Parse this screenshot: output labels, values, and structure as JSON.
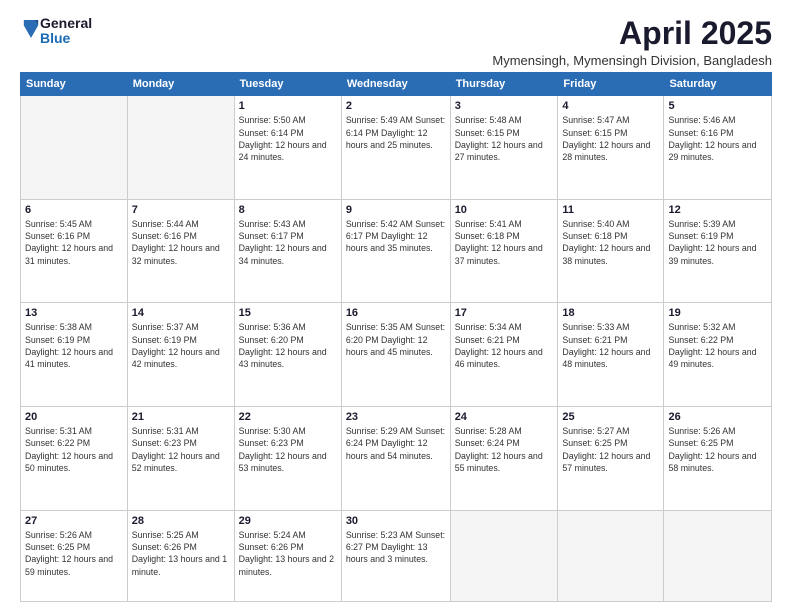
{
  "logo": {
    "general": "General",
    "blue": "Blue"
  },
  "title": "April 2025",
  "subtitle": "Mymensingh, Mymensingh Division, Bangladesh",
  "days_header": [
    "Sunday",
    "Monday",
    "Tuesday",
    "Wednesday",
    "Thursday",
    "Friday",
    "Saturday"
  ],
  "weeks": [
    [
      {
        "day": "",
        "detail": ""
      },
      {
        "day": "",
        "detail": ""
      },
      {
        "day": "1",
        "detail": "Sunrise: 5:50 AM\nSunset: 6:14 PM\nDaylight: 12 hours\nand 24 minutes."
      },
      {
        "day": "2",
        "detail": "Sunrise: 5:49 AM\nSunset: 6:14 PM\nDaylight: 12 hours\nand 25 minutes."
      },
      {
        "day": "3",
        "detail": "Sunrise: 5:48 AM\nSunset: 6:15 PM\nDaylight: 12 hours\nand 27 minutes."
      },
      {
        "day": "4",
        "detail": "Sunrise: 5:47 AM\nSunset: 6:15 PM\nDaylight: 12 hours\nand 28 minutes."
      },
      {
        "day": "5",
        "detail": "Sunrise: 5:46 AM\nSunset: 6:16 PM\nDaylight: 12 hours\nand 29 minutes."
      }
    ],
    [
      {
        "day": "6",
        "detail": "Sunrise: 5:45 AM\nSunset: 6:16 PM\nDaylight: 12 hours\nand 31 minutes."
      },
      {
        "day": "7",
        "detail": "Sunrise: 5:44 AM\nSunset: 6:16 PM\nDaylight: 12 hours\nand 32 minutes."
      },
      {
        "day": "8",
        "detail": "Sunrise: 5:43 AM\nSunset: 6:17 PM\nDaylight: 12 hours\nand 34 minutes."
      },
      {
        "day": "9",
        "detail": "Sunrise: 5:42 AM\nSunset: 6:17 PM\nDaylight: 12 hours\nand 35 minutes."
      },
      {
        "day": "10",
        "detail": "Sunrise: 5:41 AM\nSunset: 6:18 PM\nDaylight: 12 hours\nand 37 minutes."
      },
      {
        "day": "11",
        "detail": "Sunrise: 5:40 AM\nSunset: 6:18 PM\nDaylight: 12 hours\nand 38 minutes."
      },
      {
        "day": "12",
        "detail": "Sunrise: 5:39 AM\nSunset: 6:19 PM\nDaylight: 12 hours\nand 39 minutes."
      }
    ],
    [
      {
        "day": "13",
        "detail": "Sunrise: 5:38 AM\nSunset: 6:19 PM\nDaylight: 12 hours\nand 41 minutes."
      },
      {
        "day": "14",
        "detail": "Sunrise: 5:37 AM\nSunset: 6:19 PM\nDaylight: 12 hours\nand 42 minutes."
      },
      {
        "day": "15",
        "detail": "Sunrise: 5:36 AM\nSunset: 6:20 PM\nDaylight: 12 hours\nand 43 minutes."
      },
      {
        "day": "16",
        "detail": "Sunrise: 5:35 AM\nSunset: 6:20 PM\nDaylight: 12 hours\nand 45 minutes."
      },
      {
        "day": "17",
        "detail": "Sunrise: 5:34 AM\nSunset: 6:21 PM\nDaylight: 12 hours\nand 46 minutes."
      },
      {
        "day": "18",
        "detail": "Sunrise: 5:33 AM\nSunset: 6:21 PM\nDaylight: 12 hours\nand 48 minutes."
      },
      {
        "day": "19",
        "detail": "Sunrise: 5:32 AM\nSunset: 6:22 PM\nDaylight: 12 hours\nand 49 minutes."
      }
    ],
    [
      {
        "day": "20",
        "detail": "Sunrise: 5:31 AM\nSunset: 6:22 PM\nDaylight: 12 hours\nand 50 minutes."
      },
      {
        "day": "21",
        "detail": "Sunrise: 5:31 AM\nSunset: 6:23 PM\nDaylight: 12 hours\nand 52 minutes."
      },
      {
        "day": "22",
        "detail": "Sunrise: 5:30 AM\nSunset: 6:23 PM\nDaylight: 12 hours\nand 53 minutes."
      },
      {
        "day": "23",
        "detail": "Sunrise: 5:29 AM\nSunset: 6:24 PM\nDaylight: 12 hours\nand 54 minutes."
      },
      {
        "day": "24",
        "detail": "Sunrise: 5:28 AM\nSunset: 6:24 PM\nDaylight: 12 hours\nand 55 minutes."
      },
      {
        "day": "25",
        "detail": "Sunrise: 5:27 AM\nSunset: 6:25 PM\nDaylight: 12 hours\nand 57 minutes."
      },
      {
        "day": "26",
        "detail": "Sunrise: 5:26 AM\nSunset: 6:25 PM\nDaylight: 12 hours\nand 58 minutes."
      }
    ],
    [
      {
        "day": "27",
        "detail": "Sunrise: 5:26 AM\nSunset: 6:25 PM\nDaylight: 12 hours\nand 59 minutes."
      },
      {
        "day": "28",
        "detail": "Sunrise: 5:25 AM\nSunset: 6:26 PM\nDaylight: 13 hours\nand 1 minute."
      },
      {
        "day": "29",
        "detail": "Sunrise: 5:24 AM\nSunset: 6:26 PM\nDaylight: 13 hours\nand 2 minutes."
      },
      {
        "day": "30",
        "detail": "Sunrise: 5:23 AM\nSunset: 6:27 PM\nDaylight: 13 hours\nand 3 minutes."
      },
      {
        "day": "",
        "detail": ""
      },
      {
        "day": "",
        "detail": ""
      },
      {
        "day": "",
        "detail": ""
      }
    ]
  ]
}
